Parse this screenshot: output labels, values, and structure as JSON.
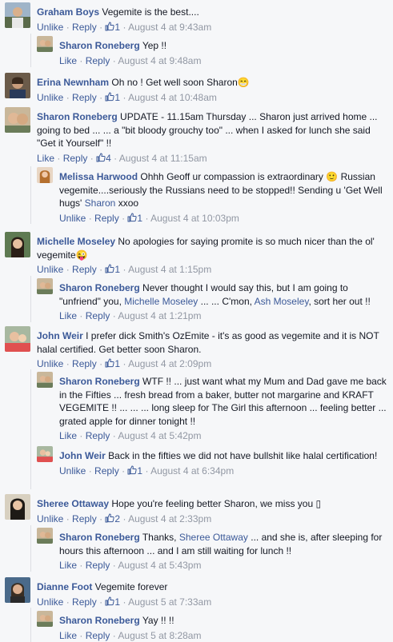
{
  "comments": [
    {
      "author": "Graham Boys",
      "text": "Vegemite is the best....",
      "like_label": "Unlike",
      "reply_label": "Reply",
      "likes": "1",
      "time": "August 4 at 9:43am"
    },
    {
      "author": "Sharon Roneberg",
      "text": "Yep !!",
      "like_label": "Like",
      "reply_label": "Reply",
      "likes": "",
      "time": "August 4 at 9:48am"
    },
    {
      "author": "Erina Newnham",
      "text": "Oh no ! Get well soon Sharon",
      "emoji": "😁",
      "like_label": "Unlike",
      "reply_label": "Reply",
      "likes": "1",
      "time": "August 4 at 10:48am"
    },
    {
      "author": "Sharon Roneberg",
      "text": "UPDATE - 11.15am Thursday ... Sharon just arrived home ... going to bed ... ... a \"bit bloody grouchy too\" ... when I asked for lunch she said \"Get it Yourself\" !!",
      "like_label": "Like",
      "reply_label": "Reply",
      "likes": "4",
      "time": "August 4 at 11:15am"
    },
    {
      "author": "Melissa Harwood",
      "text_a": "Ohhh Geoff ur compassion is extraordinary",
      "emoji": "🙂",
      "text_b": "Russian vegemite....seriously the Russians need to be stopped!! Sending u 'Get Well hugs'",
      "mention": "Sharon",
      "text_c": "xxoo",
      "like_label": "Unlike",
      "reply_label": "Reply",
      "likes": "1",
      "time": "August 4 at 10:03pm"
    },
    {
      "author": "Michelle Moseley",
      "text": "No apologies for saying promite is so much nicer than the ol' vegemite",
      "emoji": "😜",
      "like_label": "Unlike",
      "reply_label": "Reply",
      "likes": "1",
      "time": "August 4 at 1:15pm"
    },
    {
      "author": "Sharon Roneberg",
      "text_a": "Never thought I would say this, but I am going to \"unfriend\" you,",
      "mention_a": "Michelle Moseley",
      "text_b": "... ... C'mon,",
      "mention_b": "Ash Moseley",
      "text_c": ", sort her out !!",
      "like_label": "Like",
      "reply_label": "Reply",
      "likes": "",
      "time": "August 4 at 1:21pm"
    },
    {
      "author": "John Weir",
      "text": "I prefer dick Smith's OzEmite - it's as good as vegemite and it is NOT halal certified. Get better soon Sharon.",
      "like_label": "Unlike",
      "reply_label": "Reply",
      "likes": "1",
      "time": "August 4 at 2:09pm"
    },
    {
      "author": "Sharon Roneberg",
      "text": "WTF !! ... just want what my Mum and Dad gave me back in the Fifties ... fresh bread from a baker, butter not margarine and KRAFT VEGEMITE !! ... ... ... long sleep for The Girl this afternoon ... feeling better ... grated apple for dinner tonight !!",
      "like_label": "Like",
      "reply_label": "Reply",
      "likes": "",
      "time": "August 4 at 5:42pm"
    },
    {
      "author": "John Weir",
      "text": "Back in the fifties we did not have bullshit like halal certification!",
      "like_label": "Unlike",
      "reply_label": "Reply",
      "likes": "1",
      "time": "August 4 at 6:34pm"
    },
    {
      "author": "Sheree Ottaway",
      "text": "Hope you're feeling better Sharon, we miss you",
      "emoji": "▯",
      "like_label": "Unlike",
      "reply_label": "Reply",
      "likes": "2",
      "time": "August 4 at 2:33pm"
    },
    {
      "author": "Sharon Roneberg",
      "text_a": "Thanks,",
      "mention": "Sheree Ottaway",
      "text_b": "... and she is, after sleeping for hours this afternoon ... and I am still waiting for lunch !!",
      "like_label": "Like",
      "reply_label": "Reply",
      "likes": "",
      "time": "August 4 at 5:43pm"
    },
    {
      "author": "Dianne Foot",
      "text": "Vegemite forever",
      "like_label": "Unlike",
      "reply_label": "Reply",
      "likes": "1",
      "time": "August 5 at 7:33am"
    },
    {
      "author": "Sharon Roneberg",
      "text": "Yay !! !!",
      "like_label": "Like",
      "reply_label": "Reply",
      "likes": "",
      "time": "August 5 at 8:28am"
    }
  ],
  "colors": {
    "link": "#3b5998",
    "meta": "#9197a3",
    "background": "#f6f7f9"
  },
  "icons": {
    "like": "thumbs-up-icon"
  }
}
